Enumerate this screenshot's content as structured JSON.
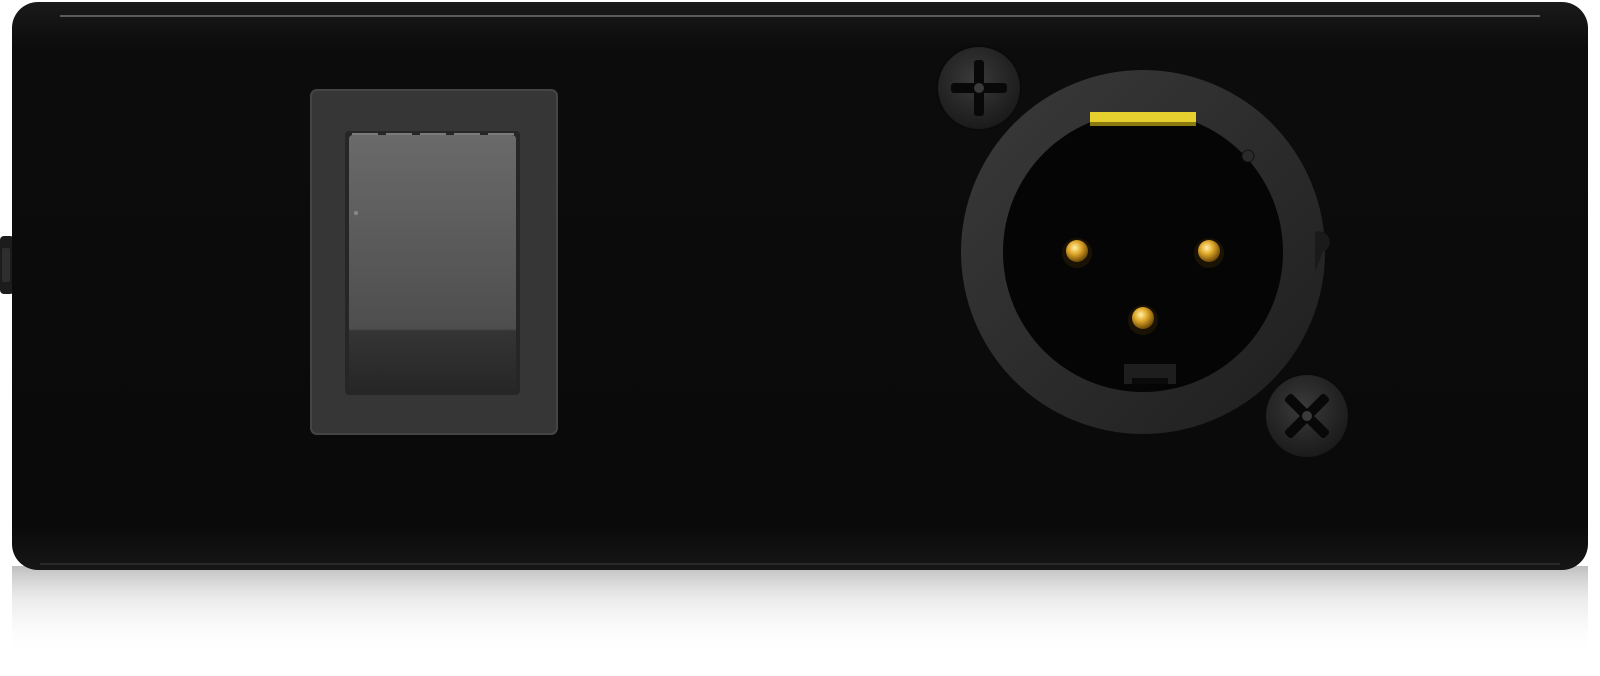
{
  "scene": {
    "subject": "device-rear-panel",
    "colors": {
      "page_background": "#ffffff",
      "panel": "#0c0c0c",
      "panel_highlight": "#6a6a6a",
      "switch_bezel": "#3a3a3a",
      "switch_rocker": "#5a5a5a",
      "xlr_ring": "#2a2a2a",
      "xlr_face": "#050505",
      "xlr_pin": "#d8a020",
      "latch_tab": "#e6d030",
      "screw": "#2a2a2a"
    },
    "components": [
      {
        "name": "rocker-switch",
        "kind": "switch"
      },
      {
        "name": "xlr-male-connector",
        "kind": "connector",
        "pins": 3
      },
      {
        "name": "mounting-screw-top",
        "kind": "screw",
        "head": "phillips"
      },
      {
        "name": "mounting-screw-bottom",
        "kind": "screw",
        "head": "phillips"
      },
      {
        "name": "side-jack",
        "kind": "connector"
      }
    ]
  }
}
